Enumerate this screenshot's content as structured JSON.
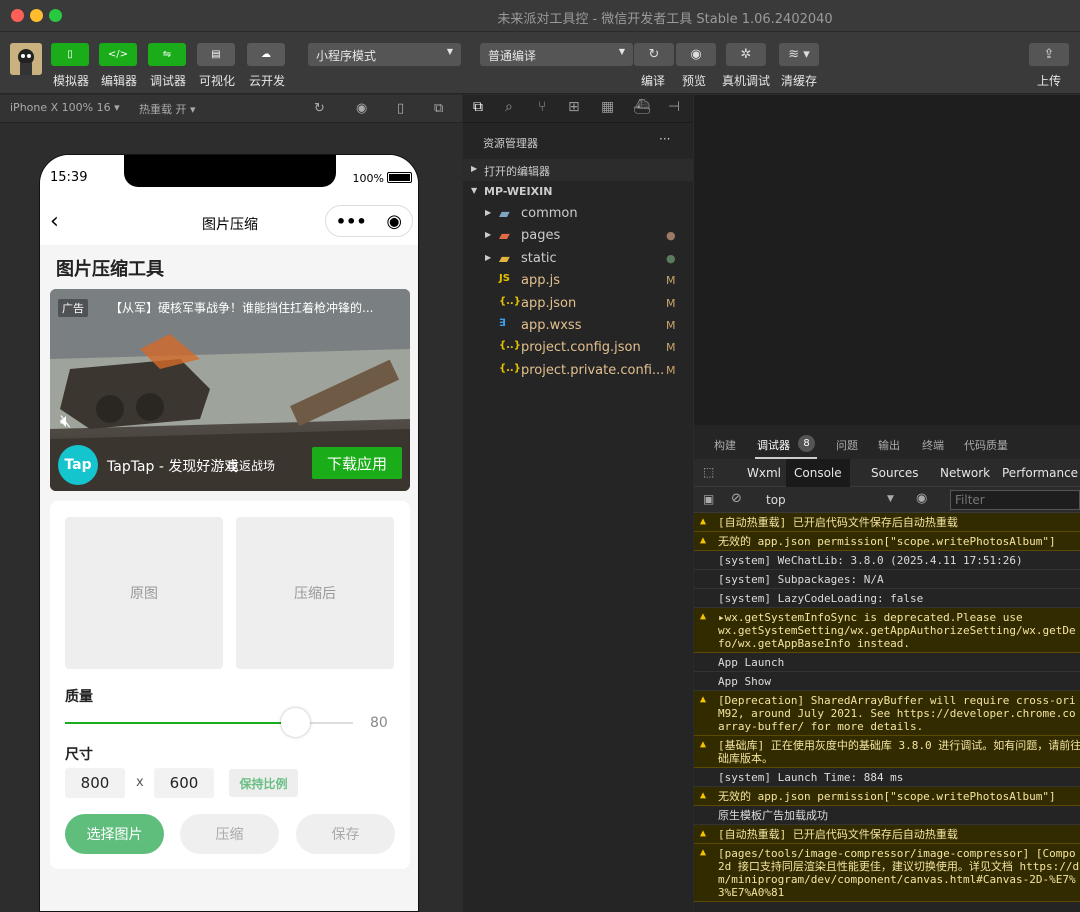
{
  "window": {
    "title": "未来派对工具控 - 微信开发者工具 Stable 1.06.2402040"
  },
  "toolbar": {
    "simulator": "模拟器",
    "editor": "编辑器",
    "debugger": "调试器",
    "visual": "可视化",
    "cloud": "云开发",
    "mode_select": "小程序模式",
    "compile_select": "普通编译",
    "compile": "编译",
    "preview": "预览",
    "realdevice": "真机调试",
    "clearcache": "清缓存",
    "upload": "上传"
  },
  "subbar": {
    "device": "iPhone X 100% 16 ▾",
    "hotreload": "热重载 开 ▾"
  },
  "phone": {
    "time": "15:39",
    "battery": "100%",
    "nav_title": "图片压缩",
    "page_title": "图片压缩工具",
    "ad": {
      "tag": "广告",
      "headline": "【从军】硬核军事战争！谁能挡住扛着枪冲锋的...",
      "brand": "TapTap - 发现好游戏",
      "brand_overlay": "重返战场",
      "logo": "Tap",
      "cta": "下载应用"
    },
    "original_label": "原图",
    "compressed_label": "压缩后",
    "quality_label": "质量",
    "quality_value": "80",
    "quality_fraction": 0.8,
    "size_label": "尺寸",
    "width": "800",
    "x": "x",
    "height": "600",
    "keep_ratio": "保持比例",
    "select_btn": "选择图片",
    "compress_btn": "压缩",
    "save_btn": "保存"
  },
  "explorer": {
    "title": "资源管理器",
    "more": "···",
    "open_editors": "打开的编辑器",
    "root": "MP-WEIXIN",
    "items": [
      {
        "name": "common",
        "badge": ""
      },
      {
        "name": "pages",
        "badge": "●"
      },
      {
        "name": "static",
        "badge": "●"
      },
      {
        "name": "app.js",
        "badge": "M"
      },
      {
        "name": "app.json",
        "badge": "M"
      },
      {
        "name": "app.wxss",
        "badge": "M"
      },
      {
        "name": "project.config.json",
        "badge": "M"
      },
      {
        "name": "project.private.confi...",
        "badge": "M"
      }
    ]
  },
  "debug": {
    "tabs": [
      "构建",
      "调试器",
      "问题",
      "输出",
      "终端",
      "代码质量"
    ],
    "badge": "8",
    "devtabs": [
      "Wxml",
      "Console",
      "Sources",
      "Network",
      "Performance"
    ],
    "context": "top",
    "filter_placeholder": "Filter",
    "lines": [
      {
        "w": true,
        "t": "[自动热重载] 已开启代码文件保存后自动热重载"
      },
      {
        "w": true,
        "t": "无效的 app.json permission[\"scope.writePhotosAlbum\"]"
      },
      {
        "w": false,
        "t": "[system] WeChatLib: 3.8.0 (2025.4.11 17:51:26)"
      },
      {
        "w": false,
        "t": "[system] Subpackages: N/A"
      },
      {
        "w": false,
        "t": "[system] LazyCodeLoading: false"
      },
      {
        "w": true,
        "t": "▸wx.getSystemInfoSync is deprecated.Please use\nwx.getSystemSetting/wx.getAppAuthorizeSetting/wx.getDe\nfo/wx.getAppBaseInfo instead."
      },
      {
        "w": false,
        "t": "App Launch"
      },
      {
        "w": false,
        "t": "App Show"
      },
      {
        "w": true,
        "t": "[Deprecation] SharedArrayBuffer will require cross-ori\nM92, around July 2021. See https://developer.chrome.co\narray-buffer/ for more details."
      },
      {
        "w": true,
        "t": "[基础库] 正在使用灰度中的基础库 3.8.0 进行调试。如有问题，请前往\n础库版本。"
      },
      {
        "w": false,
        "t": "[system] Launch Time: 884 ms"
      },
      {
        "w": true,
        "t": "无效的 app.json permission[\"scope.writePhotosAlbum\"]"
      },
      {
        "w": false,
        "t": "原生模板广告加载成功"
      },
      {
        "w": true,
        "t": "[自动热重载] 已开启代码文件保存后自动热重载"
      },
      {
        "w": true,
        "t": "[pages/tools/image-compressor/image-compressor] [Compo\n2d 接口支持同层渲染且性能更佳，建议切换使用。详见文档 https://d\nm/miniprogram/dev/component/canvas.html#Canvas-2D-%E7%\n3%E7%A0%81"
      }
    ]
  }
}
